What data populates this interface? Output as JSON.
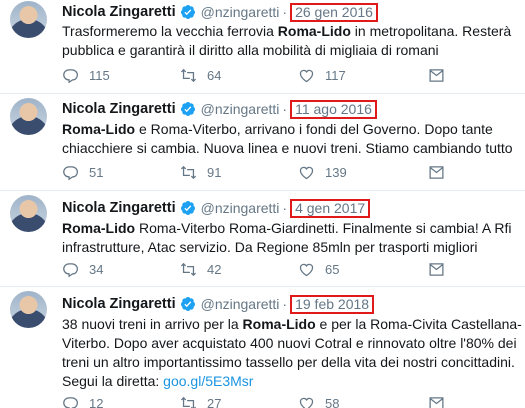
{
  "tweets": [
    {
      "name": "Nicola Zingaretti",
      "handle": "@nzingaretti",
      "date": "26 gen 2016",
      "text_parts": [
        "Trasformeremo la vecchia ferrovia ",
        "Roma-Lido",
        " in metropolitana. Resterà pubblica e garantirà il diritto alla mobilità di migliaia di romani"
      ],
      "replies": "115",
      "retweets": "64",
      "likes": "117"
    },
    {
      "name": "Nicola Zingaretti",
      "handle": "@nzingaretti",
      "date": "11 ago 2016",
      "text_parts": [
        "Roma-Lido",
        " e Roma-Viterbo, arrivano i fondi del Governo. Dopo tante chiacchiere si cambia. Nuova linea e nuovi treni. Stiamo cambiando tutto"
      ],
      "replies": "51",
      "retweets": "91",
      "likes": "139"
    },
    {
      "name": "Nicola Zingaretti",
      "handle": "@nzingaretti",
      "date": "4 gen 2017",
      "text_parts": [
        "Roma-Lido",
        " Roma-Viterbo Roma-Giardinetti. Finalmente si cambia! A Rfi infrastrutture, Atac servizio. Da Regione 85mln per trasporti migliori"
      ],
      "replies": "34",
      "retweets": "42",
      "likes": "65"
    },
    {
      "name": "Nicola Zingaretti",
      "handle": "@nzingaretti",
      "date": "19 feb 2018",
      "text_parts": [
        "38 nuovi treni in arrivo per la ",
        "Roma-Lido",
        " e per la Roma-Civita Castellana-Viterbo. Dopo aver acquistato 400 nuovi Cotral e rinnovato oltre l'80% dei treni un altro importantissimo tassello per della vita dei nostri concittadini. Segui la diretta: "
      ],
      "link": "goo.gl/5E3Msr",
      "replies": "12",
      "retweets": "27",
      "likes": "58"
    }
  ],
  "separator": "·",
  "colors": {
    "accent": "#1b95e0",
    "highlight_box": "#e0191b",
    "secondary_text": "#657786"
  },
  "icons": [
    "verified-badge-icon",
    "reply-icon",
    "retweet-icon",
    "like-icon",
    "direct-message-icon"
  ]
}
